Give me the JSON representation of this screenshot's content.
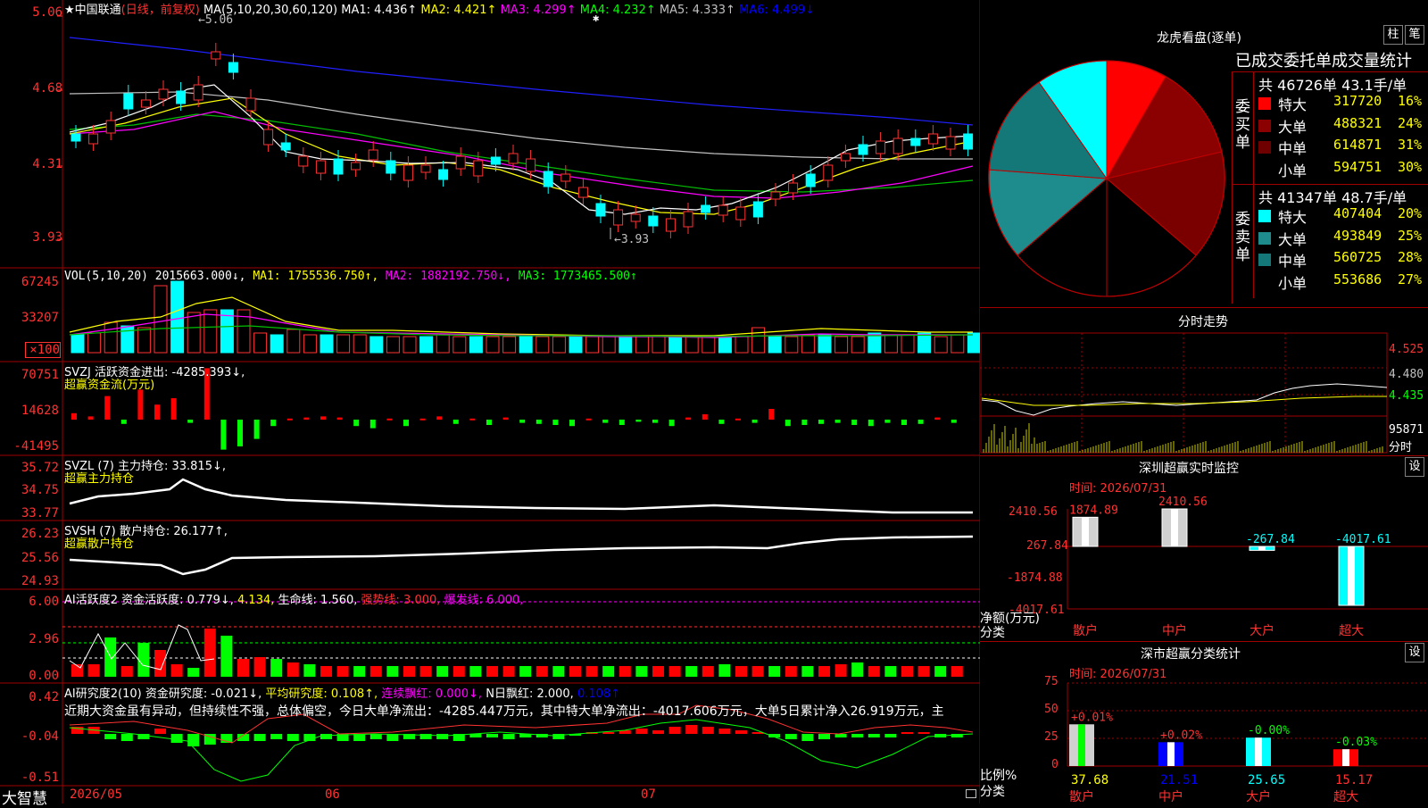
{
  "stock": {
    "name": "★中国联通",
    "mode": "(日线，前复权)",
    "ma_label": "MA(5,10,20,30,60,120)",
    "ma1": "MA1: 4.436↑",
    "ma2": "MA2: 4.421↑",
    "ma3": "MA3: 4.299↑",
    "ma4": "MA4: 4.232↑",
    "ma5": "MA5: 4.333↑",
    "ma6": "MA6: 4.499↓",
    "high_mark": "5.06",
    "low_mark": "3.93"
  },
  "price_axis": [
    "5.06",
    "4.68",
    "4.31",
    "3.93"
  ],
  "vol": {
    "label": "VOL(5,10,20) 2015663.000↓,",
    "ma1": "MA1: 1755536.750↑,",
    "ma2": "MA2: 1882192.750↓,",
    "ma3": "MA3: 1773465.500↑",
    "axis": [
      "67245",
      "33207",
      "×100"
    ]
  },
  "svzj": {
    "label": "SVZJ  活跃资金进出: -4285.393↓,",
    "sub": "超赢资金流(万元)",
    "axis": [
      "70751",
      "14628",
      "-41495"
    ]
  },
  "svzl": {
    "label": "SVZL (7) 主力持仓: 33.815↓,",
    "sub": "超赢主力持仓",
    "axis": [
      "35.72",
      "34.75",
      "33.77"
    ]
  },
  "svsh": {
    "label": "SVSH (7) 散户持仓: 26.177↑,",
    "sub": "超赢散户持仓",
    "axis": [
      "26.23",
      "25.56",
      "24.93"
    ]
  },
  "ai1": {
    "label": "AI活跃度2 资金活跃度: 0.779↓,",
    "v2": "4.134,",
    "life": "生命线: 1.560,",
    "strong": "强势线: 3.000,",
    "burst": "爆发线: 6.000,",
    "axis": [
      "6.00",
      "2.96",
      "0.00"
    ]
  },
  "ai2": {
    "label": "AI研究度2(10) 资金研究度: -0.021↓,",
    "avg": "平均研究度: 0.108↑,",
    "cont": "连续飘红: 0.000↓,",
    "ndays": "N日飘红: 2.000,",
    "v": "0.108↑",
    "comment": "近期大资金虽有异动，但持续性不强，总体偏空，今日大单净流出：-4285.447万元，其中特大单净流出：-4017.606万元，大单5日累计净入26.919万元，主",
    "axis": [
      "0.42",
      "-0.04",
      "-0.51"
    ]
  },
  "bottom": {
    "brand": "大智慧",
    "dates": [
      "2026/05",
      "06",
      "07"
    ]
  },
  "right": {
    "dragon_title": "龙虎看盘(逐单)",
    "btn_bar": "柱",
    "btn_pen": "笔",
    "stat_title": "已成交委托单成交量统计",
    "buy_total": "共 46726单 43.1手/单",
    "buy_side": "委买单",
    "buy_rows": [
      {
        "label": "特大",
        "value": "317720",
        "pct": "16%"
      },
      {
        "label": "大单",
        "value": "488321",
        "pct": "24%"
      },
      {
        "label": "中单",
        "value": "614871",
        "pct": "31%"
      },
      {
        "label": "小单",
        "value": "594751",
        "pct": "30%"
      }
    ],
    "sell_total": "共 41347单 48.7手/单",
    "sell_side": "委卖单",
    "sell_rows": [
      {
        "label": "特大",
        "value": "407404",
        "pct": "20%"
      },
      {
        "label": "大单",
        "value": "493849",
        "pct": "25%"
      },
      {
        "label": "中单",
        "value": "560725",
        "pct": "28%"
      },
      {
        "label": "小单",
        "value": "553686",
        "pct": "27%"
      }
    ],
    "colors": {
      "buy": [
        "#ff0000",
        "#8b0000",
        "#6e0000",
        "#000000"
      ],
      "sell": [
        "#00ffff",
        "#1e8c8c",
        "#147878",
        "#000000"
      ]
    },
    "intraday_title": "分时走势",
    "intraday_axis": [
      "4.525",
      "4.480",
      "4.435",
      "95871",
      "分时"
    ],
    "sz_title": "深圳超赢实时监控",
    "sz_btn": "设",
    "sz_time": "时间: 2026/07/31",
    "sz_axis": [
      "2410.56",
      "267.84",
      "-1874.88",
      "-4017.61"
    ],
    "sz_ylabel": "净额(万元)",
    "sz_xcat": "分类",
    "sz_bars": [
      {
        "cat": "散户",
        "value": "1874.89"
      },
      {
        "cat": "中户",
        "value": "2410.56"
      },
      {
        "cat": "大户",
        "value": "-267.84"
      },
      {
        "cat": "超大",
        "value": "-4017.61"
      }
    ],
    "cls_title": "深市超赢分类统计",
    "cls_btn": "设",
    "cls_time": "时间: 2026/07/31",
    "cls_axis": [
      "75",
      "50",
      "25",
      "0"
    ],
    "cls_ylabel": "比例%",
    "cls_xcat": "分类",
    "cls_bars": [
      {
        "cat": "散户",
        "change": "+0.01%",
        "pct": "37.68"
      },
      {
        "cat": "中户",
        "change": "+0.02%",
        "pct": "21.51"
      },
      {
        "cat": "大户",
        "change": "-0.00%",
        "pct": "25.65"
      },
      {
        "cat": "超大",
        "change": "-0.03%",
        "pct": "15.17"
      }
    ]
  }
}
